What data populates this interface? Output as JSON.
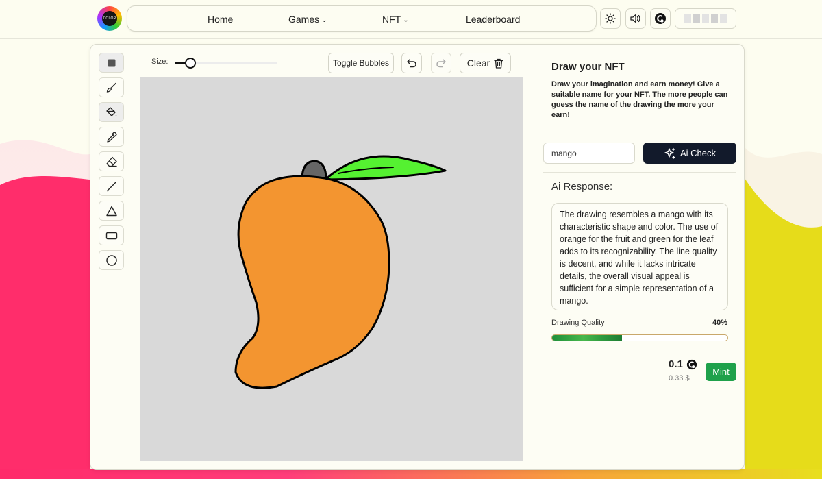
{
  "nav": {
    "logo_text": "COLOR",
    "items": [
      {
        "label": "Home",
        "has_dropdown": false
      },
      {
        "label": "Games",
        "has_dropdown": true
      },
      {
        "label": "NFT",
        "has_dropdown": true
      },
      {
        "label": "Leaderboard",
        "has_dropdown": false
      }
    ],
    "icons": [
      "sun-icon",
      "volume-icon",
      "coin-icon"
    ]
  },
  "toolbar": {
    "tools": [
      "square-icon",
      "brush-icon",
      "fill-bucket-icon",
      "eyedropper-icon",
      "eraser-icon",
      "line-icon",
      "triangle-icon",
      "rectangle-icon",
      "circle-icon"
    ],
    "size_label": "Size:",
    "size_value": 0.15,
    "toggle_bubbles_label": "Toggle Bubbles",
    "clear_label": "Clear"
  },
  "canvas": {
    "drawing": "mango",
    "colors": {
      "background": "#d9d9d9",
      "fruit": "#f39530",
      "leaf": "#55f131",
      "stem": "#666666",
      "outline": "#000000"
    }
  },
  "panel": {
    "title": "Draw your NFT",
    "description": "Draw your imagination and earn money! Give a suitable name for your NFT. The more people can guess the name of the drawing the more your earn!",
    "name_value": "mango",
    "ai_check_label": "Ai Check",
    "response_label": "Ai Response:",
    "response_text": "The drawing resembles a mango with its characteristic shape and color. The use of orange for the fruit and green for the leaf adds to its recognizability. The line quality is decent, and while it lacks intricate details, the overall visual appeal is sufficient for a simple representation of a mango.",
    "quality_label": "Drawing Quality",
    "quality_percent_text": "40%",
    "quality_value": 0.4,
    "price": "0.1",
    "price_usd": "0.33 $",
    "mint_label": "Mint"
  },
  "colors": {
    "accent_dark": "#121a2b",
    "mint_green": "#1fa14b",
    "page_bg": "#fdfdf0"
  }
}
